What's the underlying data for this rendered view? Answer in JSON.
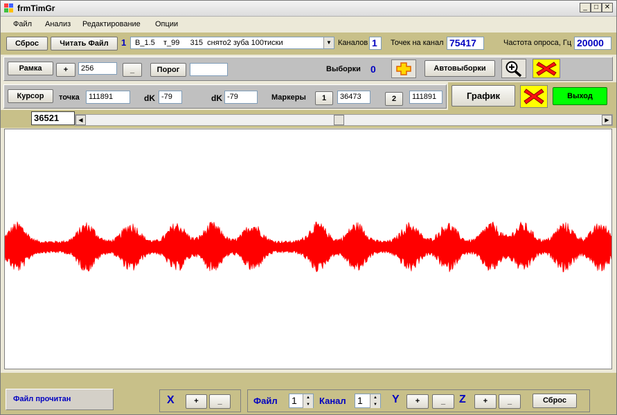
{
  "window": {
    "title": "frmTimGr"
  },
  "menu": [
    "Файл",
    "Анализ",
    "Редактирование",
    "Опции"
  ],
  "row1": {
    "reset": "Сброс",
    "read_file": "Читать Файл",
    "file_index": "1",
    "file_select": "В_1.5    т_99     315  снято2 зуба 100тиски",
    "channels_label": "Каналов",
    "channels_value": "1",
    "points_label": "Точек на канал",
    "points_value": "75417",
    "freq_label": "Частота опроса, Гц",
    "freq_value": "20000"
  },
  "row2": {
    "frame": "Рамка",
    "plus": "+",
    "frame_value": "256",
    "minus": "_",
    "threshold": "Порог",
    "threshold_value": "",
    "samples_label": "Выборки",
    "samples_value": "0",
    "auto_samples": "Автовыборки"
  },
  "row3": {
    "cursor": "Курсор",
    "point_label": "точка",
    "point_value": "111891",
    "dk_label": "dK",
    "dk_value1": "-79",
    "dk_label2": "dK",
    "dk_value2": "-79",
    "markers_label": "Маркеры",
    "marker1_btn": "1",
    "marker1_value": "36473",
    "marker2_btn": "2",
    "marker2_value": "111891",
    "graph": "График",
    "exit": "Выход"
  },
  "scroll": {
    "position_value": "36521",
    "thumb_fraction": 0.49
  },
  "status": {
    "text": "Файл прочитан"
  },
  "bottom": {
    "x_label": "X",
    "x_plus": "+",
    "x_minus": "_",
    "file_label": "Файл",
    "file_spin": "1",
    "channel_label": "Канал",
    "channel_spin": "1",
    "y_label": "Y",
    "y_plus": "+",
    "y_minus": "_",
    "z_label": "Z",
    "z_plus": "+",
    "z_minus": "_",
    "reset": "Сброс"
  },
  "colors": {
    "signal": "#ff0000",
    "accent_blue": "#0000c0",
    "exit_green": "#00ff00",
    "olive": "#c8c089",
    "close_icon_bg": "#ffff00"
  },
  "icons": [
    "app-icon",
    "plus-cross-icon",
    "zoom-in-icon",
    "red-x-icon"
  ]
}
